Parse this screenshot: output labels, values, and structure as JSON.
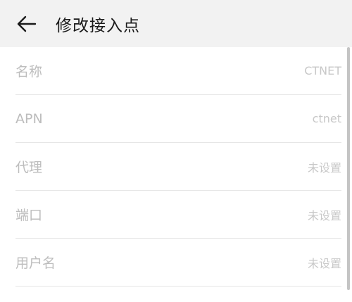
{
  "header": {
    "back_icon": "arrow-left-icon",
    "title": "修改接入点"
  },
  "apn_fields": [
    {
      "label": "名称",
      "value": "CTNET"
    },
    {
      "label": "APN",
      "value": "ctnet"
    },
    {
      "label": "代理",
      "value": "未设置"
    },
    {
      "label": "端口",
      "value": "未设置"
    },
    {
      "label": "用户名",
      "value": "未设置"
    }
  ]
}
